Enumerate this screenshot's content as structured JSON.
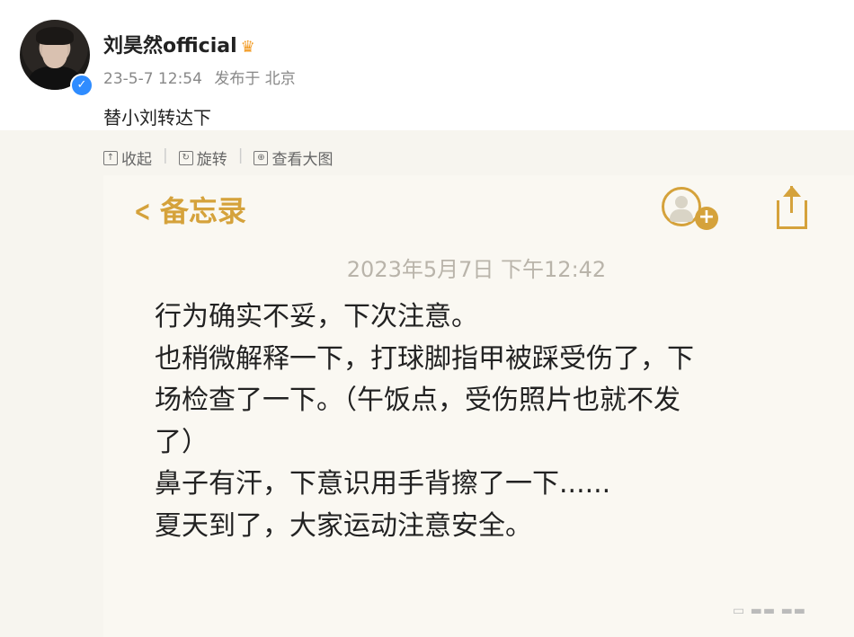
{
  "post": {
    "username": "刘昊然official",
    "time": "23-5-7 12:54",
    "location": "发布于 北京",
    "text": "替小刘转达下"
  },
  "toolbar": {
    "collapse_label": "收起",
    "rotate_label": "旋转",
    "view_large_label": "查看大图"
  },
  "memo": {
    "back_label": "备忘录",
    "date": "2023年5月7日 下午12:42",
    "lines": [
      "行为确实不妥，下次注意。",
      "也稍微解释一下，打球脚指甲被踩受伤了，下",
      "场检查了一下。（午饭点，受伤照片也就不发",
      "了）",
      "鼻子有汗，下意识用手背擦了一下......",
      "夏天到了，大家运动注意安全。"
    ]
  },
  "colors": {
    "accent": "#d5a23b",
    "verified": "#2f8cff"
  }
}
